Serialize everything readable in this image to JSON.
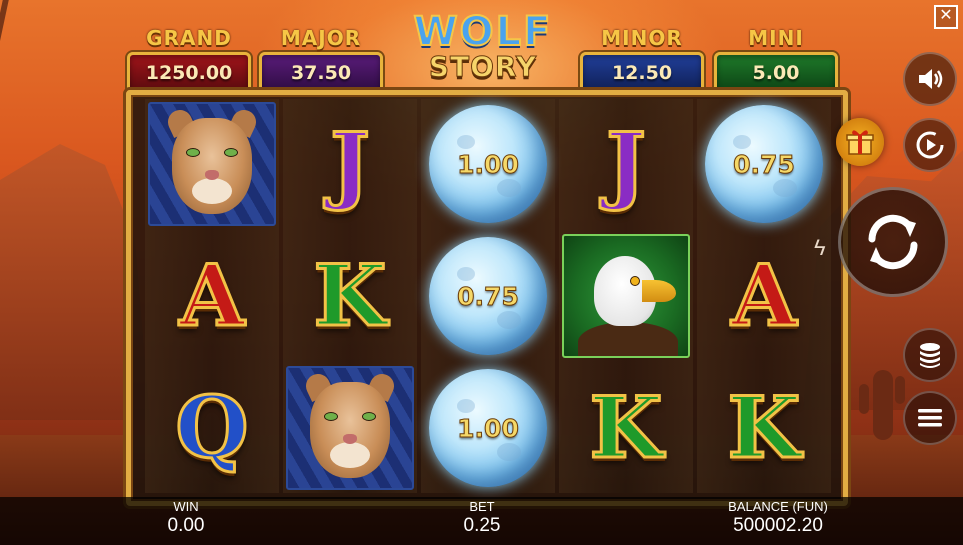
{
  "window": {
    "close_label": "✕"
  },
  "jackpots": [
    {
      "name": "GRAND",
      "value": "1250.00"
    },
    {
      "name": "MAJOR",
      "value": "37.50"
    },
    {
      "name": "MINOR",
      "value": "12.50"
    },
    {
      "name": "MINI",
      "value": "5.00"
    }
  ],
  "logo": {
    "line1": "WOLF",
    "line2": "STORY"
  },
  "reels": [
    [
      "puma",
      "A",
      "Q"
    ],
    [
      "J",
      "K",
      "puma"
    ],
    [
      "1.00",
      "0.75",
      "1.00"
    ],
    [
      "J",
      "eagle",
      "K"
    ],
    [
      "0.75",
      "A",
      "K"
    ]
  ],
  "reel_cells": {
    "r1c1": "A",
    "r1c2": "Q",
    "r2c0": "J",
    "r2c1": "K",
    "r3c0": "1.00",
    "r3c1": "0.75",
    "r3c2": "1.00",
    "r4c0": "J",
    "r4c2": "K",
    "r5c0": "0.75",
    "r5c1": "A",
    "r5c2": "K"
  },
  "buttons": {
    "sound": "speaker-icon",
    "autoplay": "autoplay-icon",
    "bonus": "gift-icon",
    "spin": "spin-icon",
    "turbo": "lightning-icon",
    "bet": "coins-icon",
    "menu": "menu-icon"
  },
  "footer": {
    "win_label": "WIN",
    "win_value": "0.00",
    "bet_label": "BET",
    "bet_value": "0.25",
    "balance_label": "BALANCE (FUN)",
    "balance_value": "500002.20"
  },
  "colors": {
    "frame_gold": "#e2ad43",
    "grand_red": "#a0141a",
    "major_purple": "#5a1c7a",
    "minor_blue": "#213f9a",
    "mini_green": "#1f7a2a"
  }
}
